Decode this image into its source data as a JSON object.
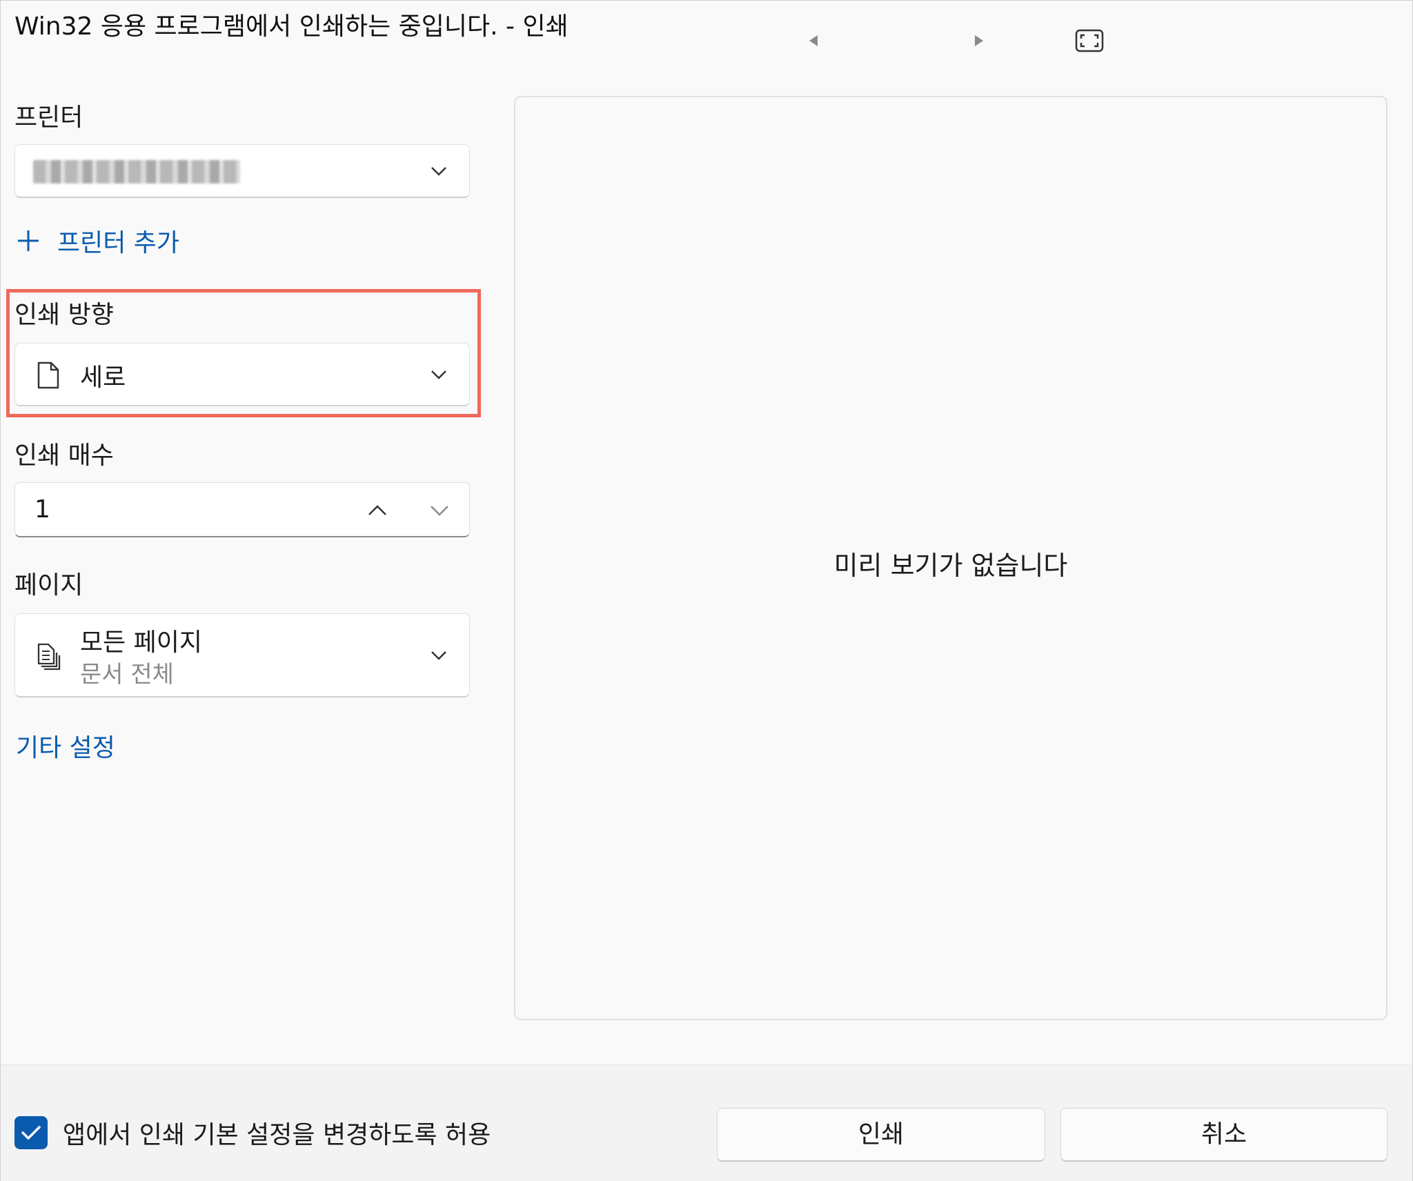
{
  "window": {
    "title": "Win32 응용 프로그램에서 인쇄하는 중입니다. - 인쇄"
  },
  "printer": {
    "label": "프린터",
    "add_printer_label": "프린터 추가"
  },
  "orientation": {
    "label": "인쇄 방향",
    "value": "세로"
  },
  "copies": {
    "label": "인쇄 매수",
    "value": "1"
  },
  "pages": {
    "label": "페이지",
    "value": "모든 페이지",
    "subvalue": "문서 전체"
  },
  "more_settings_label": "기타 설정",
  "preview": {
    "message": "미리 보기가 없습니다"
  },
  "footer": {
    "allow_app_settings_label": "앱에서 인쇄 기본 설정을 변경하도록 허용",
    "allow_app_settings_checked": true,
    "print_button": "인쇄",
    "cancel_button": "취소"
  },
  "colors": {
    "accent": "#0a5bad",
    "highlight": "#ef6a5a"
  }
}
